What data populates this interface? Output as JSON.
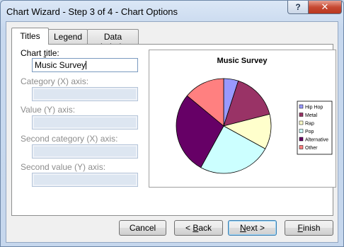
{
  "window": {
    "title": "Chart Wizard - Step 3 of 4 - Chart Options",
    "help_label": "?",
    "close_label": "✕"
  },
  "tabs": [
    {
      "label": "Titles",
      "active": true
    },
    {
      "label": "Legend",
      "active": false
    },
    {
      "label": "Data Labels",
      "active": false
    }
  ],
  "fields": {
    "chart_title": {
      "label_pre": "Chart ",
      "label_key": "t",
      "label_post": "itle:",
      "value": "Music Survey"
    },
    "category_x": {
      "label": "Category (X) axis:",
      "value": ""
    },
    "value_y": {
      "label": "Value (Y) axis:",
      "value": ""
    },
    "second_category_x": {
      "label": "Second category (X) axis:",
      "value": ""
    },
    "second_value_y": {
      "label": "Second value (Y) axis:",
      "value": ""
    }
  },
  "buttons": {
    "cancel": "Cancel",
    "back_pre": "< ",
    "back_key": "B",
    "back_post": "ack",
    "next_pre": "",
    "next_key": "N",
    "next_post": "ext >",
    "finish_pre": "",
    "finish_key": "F",
    "finish_post": "inish"
  },
  "chart_data": {
    "type": "pie",
    "title": "Music Survey",
    "categories": [
      "Hip Hop",
      "Metal",
      "Rap",
      "Pop",
      "Alternative",
      "Other"
    ],
    "values": [
      5,
      16,
      12,
      25,
      28,
      14
    ],
    "colors": [
      "#9999ff",
      "#993366",
      "#ffffcc",
      "#ccffff",
      "#660066",
      "#ff8080"
    ],
    "legend": "right"
  }
}
